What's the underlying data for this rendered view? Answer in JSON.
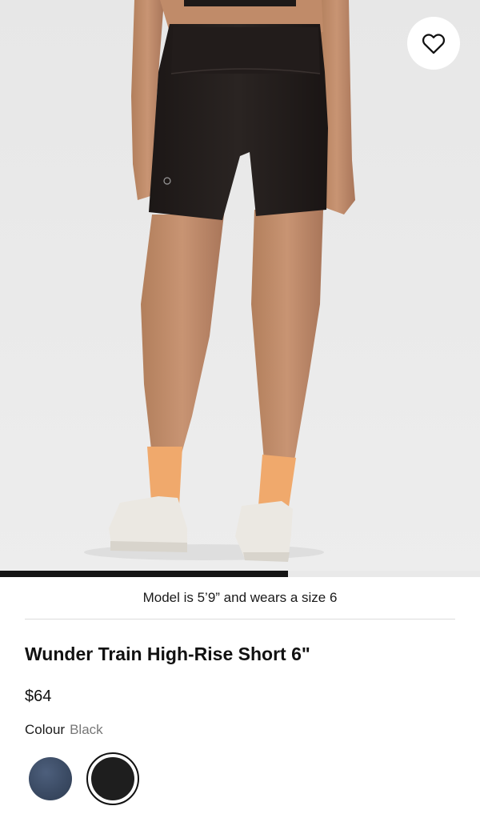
{
  "product_image": {
    "icon": "product-photo",
    "carousel_progress": 0.6,
    "progress_color": "#151515"
  },
  "wishlist": {
    "icon": "heart-icon"
  },
  "model_note": "Model is 5’9” and wears a size 6",
  "product": {
    "title": "Wunder Train High-Rise Short 6\"",
    "price": "$64"
  },
  "colour": {
    "label": "Colour",
    "selected": "Black",
    "swatches": [
      {
        "color": "#3b4b64",
        "selected": false
      },
      {
        "color": "#1e1e1e",
        "selected": true
      }
    ]
  }
}
